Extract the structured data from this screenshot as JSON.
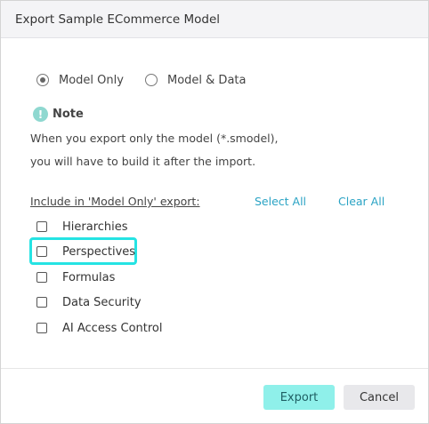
{
  "dialog": {
    "title": "Export Sample ECommerce Model"
  },
  "export_mode": {
    "options": [
      {
        "label": "Model Only",
        "checked": true
      },
      {
        "label": "Model & Data",
        "checked": false
      }
    ]
  },
  "note": {
    "icon": "exclamation-icon",
    "title": "Note",
    "lines": [
      "When you export only the model (*.smodel),",
      "you will have to build it after the import."
    ]
  },
  "include": {
    "label": "Include in 'Model Only' export:",
    "select_all": "Select All",
    "clear_all": "Clear All",
    "items": [
      {
        "label": "Hierarchies",
        "checked": false
      },
      {
        "label": "Perspectives",
        "checked": false,
        "focused": true
      },
      {
        "label": "Formulas",
        "checked": false
      },
      {
        "label": "Data Security",
        "checked": false
      },
      {
        "label": "AI Access Control",
        "checked": false
      }
    ]
  },
  "footer": {
    "export_label": "Export",
    "cancel_label": "Cancel"
  },
  "colors": {
    "accent": "#2aa3c4",
    "export_button": "#8ff0ea",
    "focus_ring": "#25e3e3",
    "note_icon": "#8fd8d0"
  }
}
